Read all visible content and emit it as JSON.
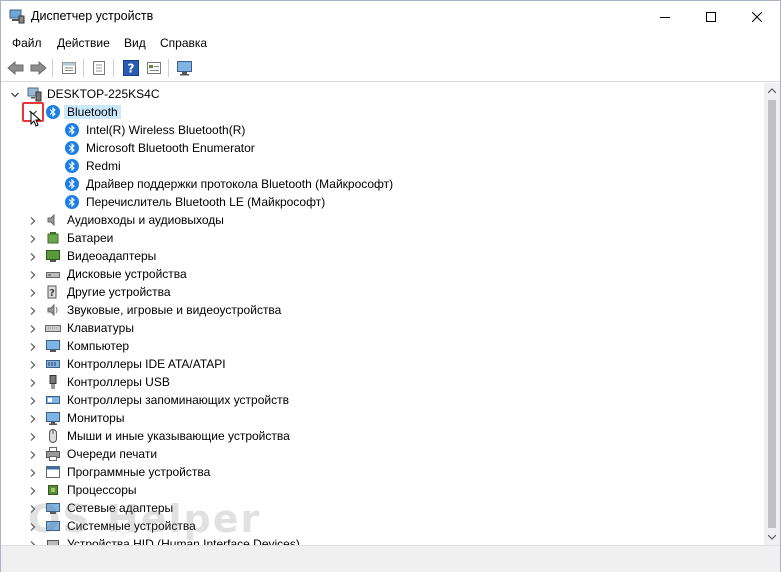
{
  "window": {
    "title": "Диспетчер устройств"
  },
  "menu": [
    "Файл",
    "Действие",
    "Вид",
    "Справка"
  ],
  "toolbar": {
    "icons": [
      "back-icon",
      "forward-icon",
      "properties-icon",
      "driver-icon",
      "help-icon",
      "view-icon",
      "monitor-scan-icon"
    ]
  },
  "tree": {
    "root": "DESKTOP-225KS4C",
    "bluetooth": {
      "label": "Bluetooth",
      "children": [
        "Intel(R) Wireless Bluetooth(R)",
        "Microsoft Bluetooth Enumerator",
        "Redmi",
        "Драйвер поддержки протокола Bluetooth (Майкрософт)",
        "Перечислитель Bluetooth LE (Майкрософт)"
      ]
    },
    "categories": [
      {
        "label": "Аудиовходы и аудиовыходы",
        "icon": "speaker-icon"
      },
      {
        "label": "Батареи",
        "icon": "battery-icon"
      },
      {
        "label": "Видеоадаптеры",
        "icon": "display-adapter-icon"
      },
      {
        "label": "Дисковые устройства",
        "icon": "disk-drive-icon"
      },
      {
        "label": "Другие устройства",
        "icon": "unknown-device-icon"
      },
      {
        "label": "Звуковые, игровые и видеоустройства",
        "icon": "sound-icon"
      },
      {
        "label": "Клавиатуры",
        "icon": "keyboard-icon"
      },
      {
        "label": "Компьютер",
        "icon": "computer-icon"
      },
      {
        "label": "Контроллеры IDE ATA/ATAPI",
        "icon": "ide-controller-icon"
      },
      {
        "label": "Контроллеры USB",
        "icon": "usb-icon"
      },
      {
        "label": "Контроллеры запоминающих устройств",
        "icon": "storage-controller-icon"
      },
      {
        "label": "Мониторы",
        "icon": "monitor-icon"
      },
      {
        "label": "Мыши и иные указывающие устройства",
        "icon": "mouse-icon"
      },
      {
        "label": "Очереди печати",
        "icon": "printer-icon"
      },
      {
        "label": "Программные устройства",
        "icon": "software-device-icon"
      },
      {
        "label": "Процессоры",
        "icon": "processor-icon"
      },
      {
        "label": "Сетевые адаптеры",
        "icon": "network-adapter-icon"
      },
      {
        "label": "Системные устройства",
        "icon": "system-device-icon"
      },
      {
        "label": "Устройства HID (Human Interface Devices)",
        "icon": "hid-icon"
      }
    ]
  },
  "watermark": "OS Helper",
  "colors": {
    "bluetooth": "#1d7fe4",
    "selection": "#cce8ff",
    "highlight": "#e8353a"
  }
}
